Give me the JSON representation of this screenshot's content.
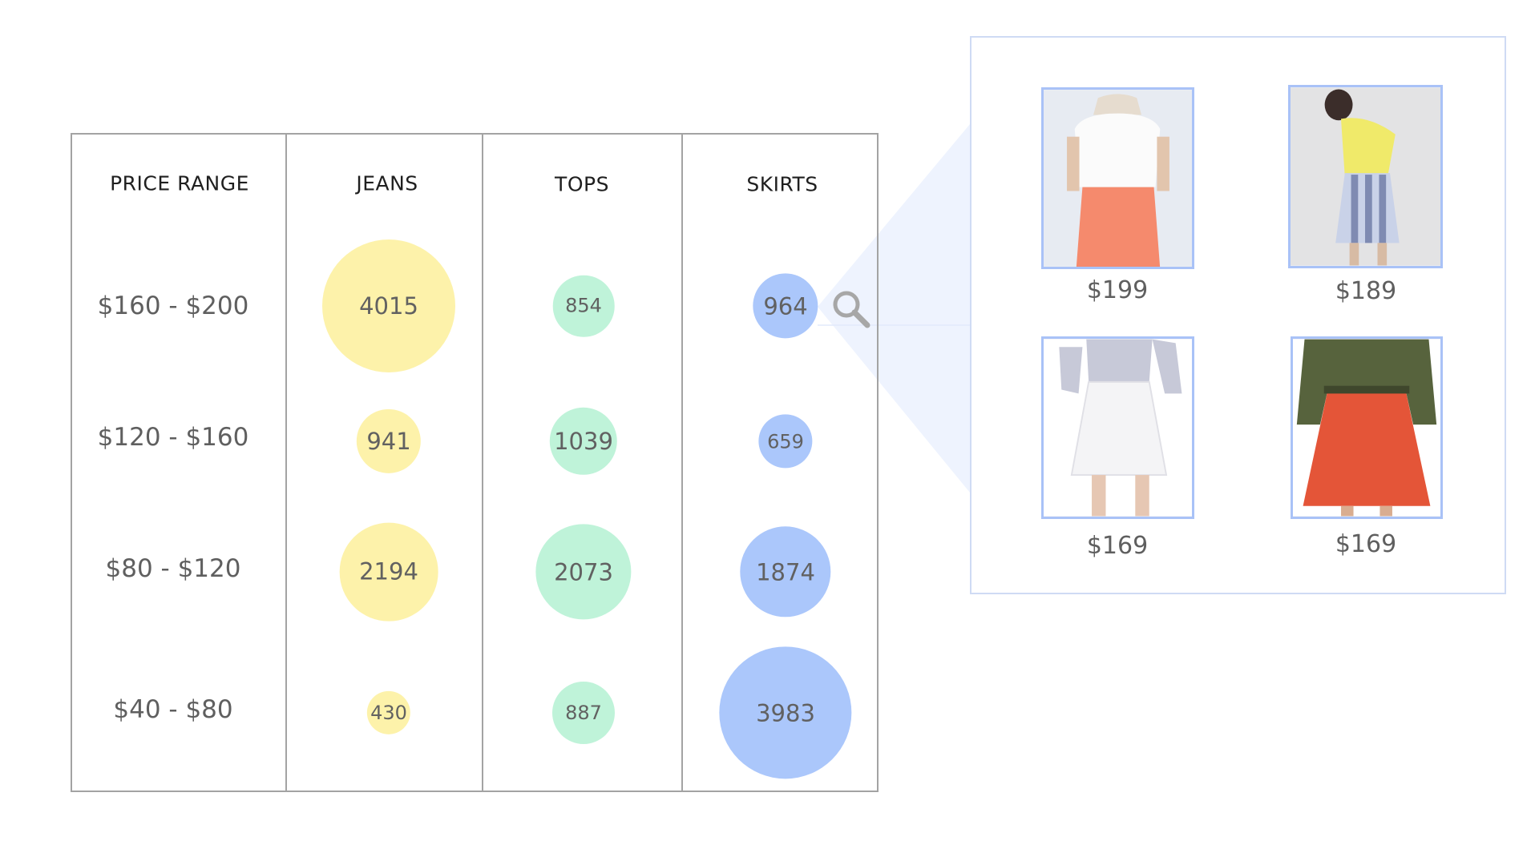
{
  "chart_data": {
    "type": "bubble-table",
    "columns": [
      "PRICE RANGE",
      "JEANS",
      "TOPS",
      "SKIRTS"
    ],
    "rows": [
      {
        "price_range": "$160 - $200",
        "values": [
          4015,
          854,
          964
        ]
      },
      {
        "price_range": "$120 - $160",
        "values": [
          941,
          1039,
          659
        ]
      },
      {
        "price_range": "$80 - $120",
        "values": [
          2194,
          2073,
          1874
        ]
      },
      {
        "price_range": "$40 - $80",
        "values": [
          430,
          887,
          3983
        ]
      }
    ],
    "series": [
      {
        "name": "JEANS",
        "color": "#fdf2aa"
      },
      {
        "name": "TOPS",
        "color": "#bff3d9"
      },
      {
        "name": "SKIRTS",
        "color": "#abc7fb"
      }
    ],
    "highlighted_cell": {
      "row": "$160 - $200",
      "column": "SKIRTS",
      "value": 964
    }
  },
  "zoom_panel": {
    "products": [
      {
        "price": "$199",
        "description": "white top, coral wrap skirt"
      },
      {
        "price": "$189",
        "description": "yellow top, blue-white striped skirt"
      },
      {
        "price": "$169",
        "description": "white pleated skirt, grey shirt"
      },
      {
        "price": "$169",
        "description": "orange flared skirt, olive jacket"
      }
    ]
  },
  "icons": {
    "magnifier": "search-icon"
  },
  "colors": {
    "grid": "#a3a3a3",
    "panel_border": "#cfdbf4",
    "thumb_border": "#a9c2f7",
    "wedge": "#eef3fe"
  }
}
